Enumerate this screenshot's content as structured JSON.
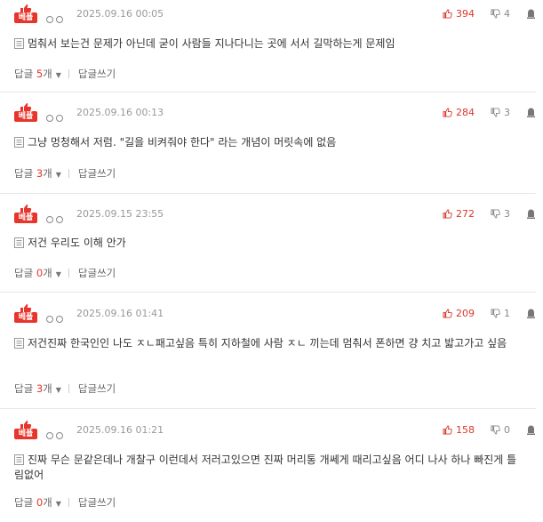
{
  "comments": [
    {
      "badge": "베플",
      "date": "2025.09.16 00:05",
      "likes": "394",
      "dislikes": "4",
      "text": "멈춰서 보는건 문제가 아닌데 굳이 사람들 지나다니는 곳에 서서 길막하는게 문제임",
      "reply_label": "답글",
      "reply_count": "5",
      "reply_unit": "개",
      "write_label": "답글쓰기"
    },
    {
      "badge": "베플",
      "date": "2025.09.16 00:13",
      "likes": "284",
      "dislikes": "3",
      "text": "그냥 멍청해서 저럼. \"길을 비켜줘야 한다\" 라는 개념이 머릿속에 없음",
      "reply_label": "답글",
      "reply_count": "3",
      "reply_unit": "개",
      "write_label": "답글쓰기"
    },
    {
      "badge": "베플",
      "date": "2025.09.15 23:55",
      "likes": "272",
      "dislikes": "3",
      "text": "저건 우리도 이해 안가",
      "reply_label": "답글",
      "reply_count": "0",
      "reply_unit": "개",
      "write_label": "답글쓰기"
    },
    {
      "badge": "베플",
      "date": "2025.09.16 01:41",
      "likes": "209",
      "dislikes": "1",
      "text": "저건진짜 한국인인 나도 ㅈㄴ패고싶음 특히 지하철에 사람 ㅈㄴ 끼는데 멈춰서 폰하면 걍 치고 밟고가고 싶음",
      "reply_label": "답글",
      "reply_count": "3",
      "reply_unit": "개",
      "write_label": "답글쓰기"
    },
    {
      "badge": "베플",
      "date": "2025.09.16 01:21",
      "likes": "158",
      "dislikes": "0",
      "text": "진짜 무슨 문같은데나 개찰구 이런데서 저러고있으면 진짜 머리통 개쎄게 때리고싶음 어디 나사 하나 빠진게 틀림없어",
      "reply_label": "답글",
      "reply_count": "0",
      "reply_unit": "개",
      "write_label": "답글쓰기"
    }
  ],
  "colors": {
    "accent": "#e8352b",
    "muted": "#999999"
  }
}
